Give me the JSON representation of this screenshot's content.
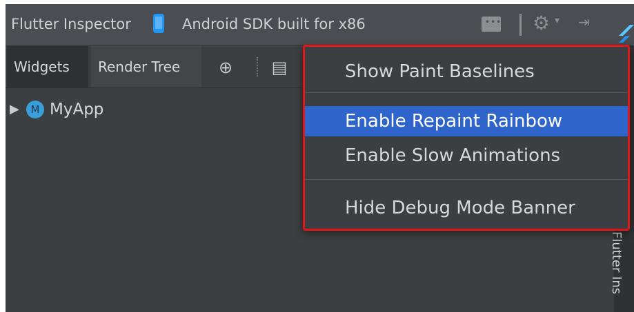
{
  "titlebar": {
    "title": "Flutter Inspector",
    "device": "Android SDK built for x86",
    "icons": [
      "device-icon",
      "chat-icon",
      "gear-icon",
      "pin-icon",
      "flutter-logo"
    ]
  },
  "tabs": [
    {
      "label": "Widgets"
    },
    {
      "label": "Render Tree"
    }
  ],
  "tree": {
    "root": {
      "icon_letter": "M",
      "label": "MyApp"
    }
  },
  "menu": {
    "items": [
      {
        "label": "Show Paint Baselines"
      },
      {
        "label": "Enable Repaint Rainbow",
        "selected": true
      },
      {
        "label": "Enable Slow Animations"
      },
      {
        "label": "Hide Debug Mode Banner"
      }
    ]
  },
  "gutter": {
    "label": "Flutter Ins"
  },
  "colors": {
    "highlight": "#2f65ca",
    "annotation_border": "#e21616",
    "panel_bg": "#3c3f41"
  }
}
